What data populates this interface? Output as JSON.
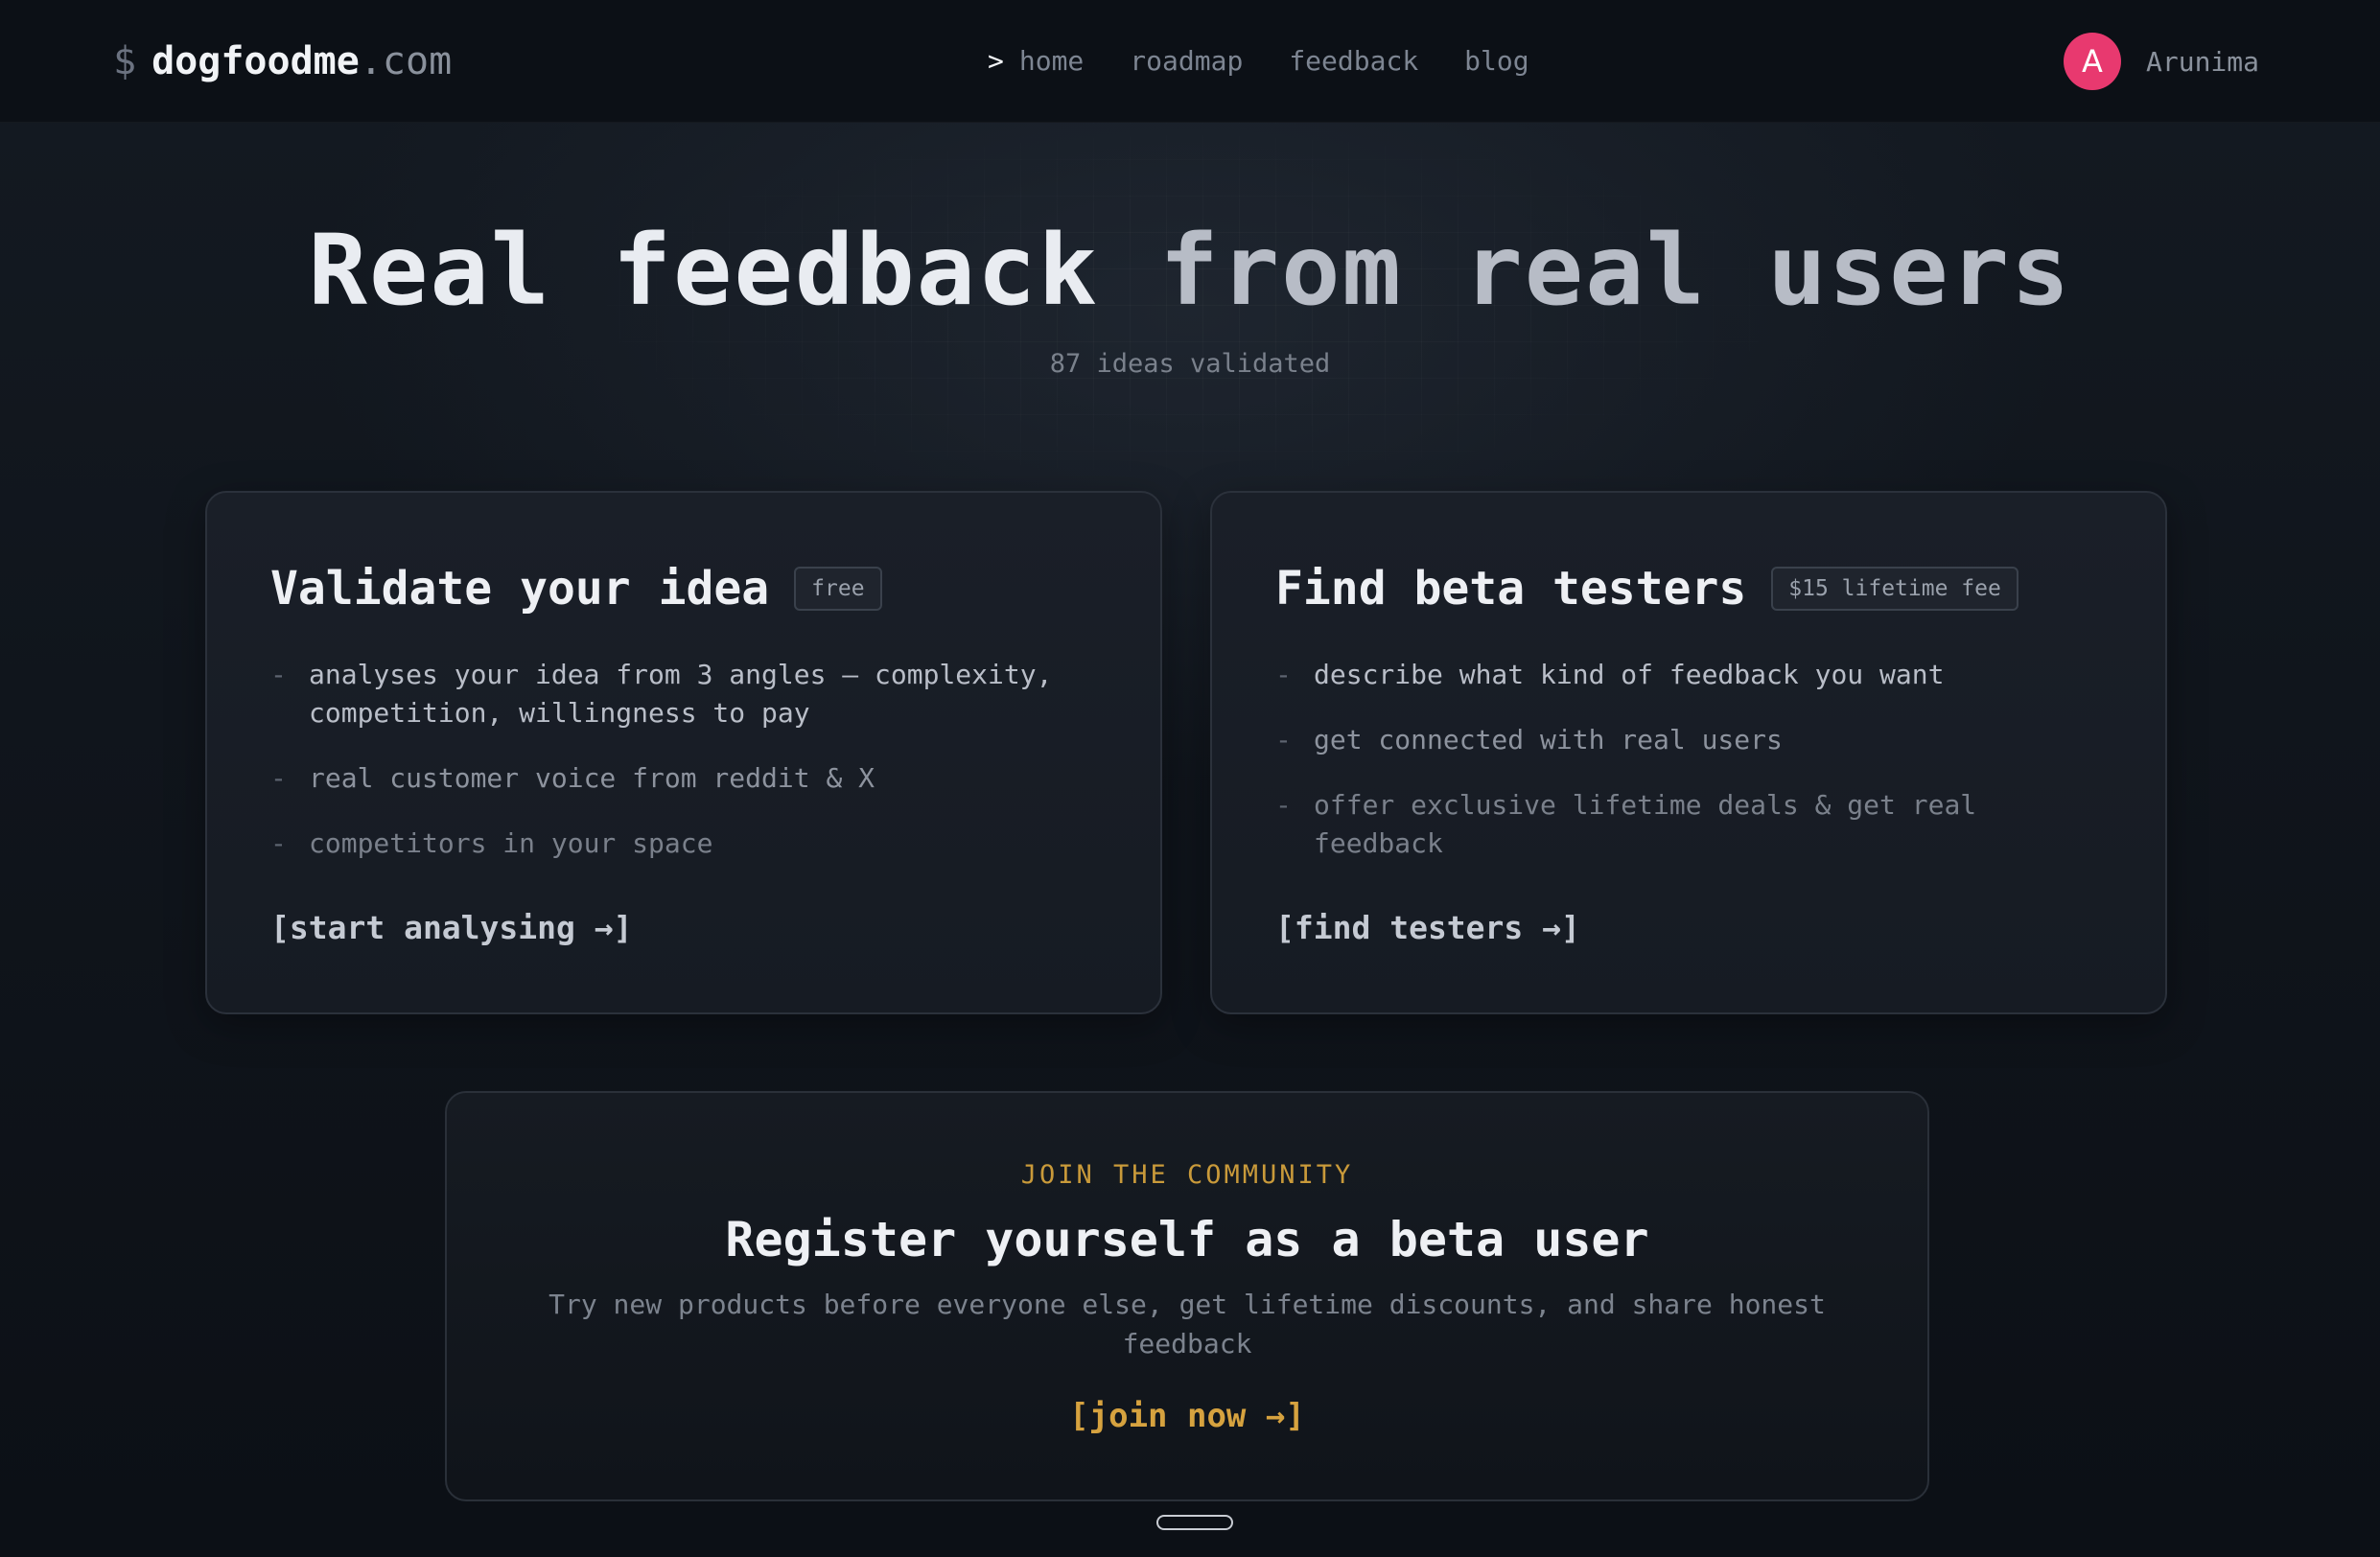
{
  "nav": {
    "logo_symbol": "$",
    "brand": "dogfoodme",
    "tld": ".com",
    "active_caret": ">",
    "links": [
      "home",
      "roadmap",
      "feedback",
      "blog"
    ],
    "user": {
      "avatar_initial": "A",
      "name": "Arunima"
    }
  },
  "hero": {
    "title_part1": "Real feedback",
    "title_part2": "from real users",
    "subtitle": "87 ideas validated"
  },
  "cards": [
    {
      "title": "Validate your idea",
      "badge": "free",
      "features": [
        "analyses your idea from 3 angles — complexity, competition, willingness to pay",
        "real customer voice from reddit & X",
        "competitors in your space"
      ],
      "cta": "[start analysing →]"
    },
    {
      "title": "Find beta testers",
      "badge": "$15 lifetime fee",
      "features": [
        "describe what kind of feedback you want",
        "get connected with real users",
        "offer exclusive lifetime deals & get real feedback"
      ],
      "cta": "[find testers →]"
    }
  ],
  "community": {
    "eyebrow": "JOIN THE COMMUNITY",
    "title": "Register yourself as a beta user",
    "description": "Try new products before everyone else, get lifetime discounts, and share honest feedback",
    "cta": "[join now →]"
  },
  "colors": {
    "accent_gold": "#d6a23f",
    "avatar_pink": "#e8396f",
    "background": "#0f141b"
  }
}
